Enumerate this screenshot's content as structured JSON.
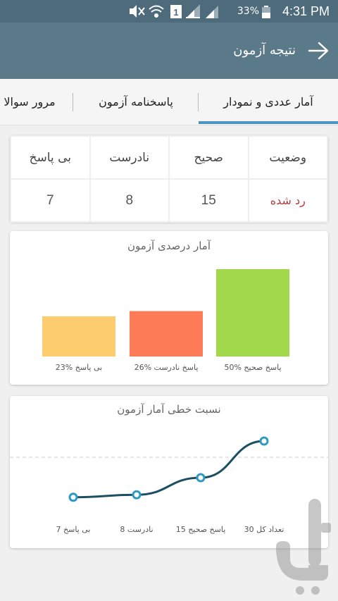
{
  "status_bar": {
    "battery": "33%",
    "time": "4:31 PM"
  },
  "app_bar": {
    "title": "نتیجه آزمون"
  },
  "tabs": [
    {
      "label": "آمار عددی و نمودار",
      "selected": true
    },
    {
      "label": "پاسخنامه آزمون",
      "selected": false
    },
    {
      "label": "مرور سوالا",
      "selected": false
    }
  ],
  "stats_table": {
    "headers": [
      "وضعیت",
      "صحیح",
      "نادرست",
      "بی پاسخ"
    ],
    "values": [
      "رد شده",
      "15",
      "8",
      "7"
    ]
  },
  "colors": {
    "status_bar": "#4d6b7b",
    "app_bar": "#5a7989",
    "tab_indicator": "#4b95c2",
    "status_fail": "#b03d3d",
    "line": "#1d4f63",
    "point_stroke": "#2e9ac4"
  },
  "chart_data": [
    {
      "type": "bar",
      "title": "آمار درصدی آزمون",
      "categories": [
        "پاسخ صحیح %50",
        "پاسخ نادرست %26",
        "بی پاسخ %23"
      ],
      "values": [
        50,
        26,
        23
      ],
      "colors": [
        "#a2d94c",
        "#fd7c57",
        "#fdcc6d"
      ],
      "ylim": [
        0,
        50
      ]
    },
    {
      "type": "line",
      "title": "نسبت خطی آمار آزمون",
      "categories": [
        "تعداد کل 30",
        "پاسخ صحیح 15",
        "نادرست 8",
        "بی پاسخ 7"
      ],
      "values": [
        30,
        15,
        8,
        7
      ],
      "ylim": [
        0,
        30
      ]
    }
  ]
}
